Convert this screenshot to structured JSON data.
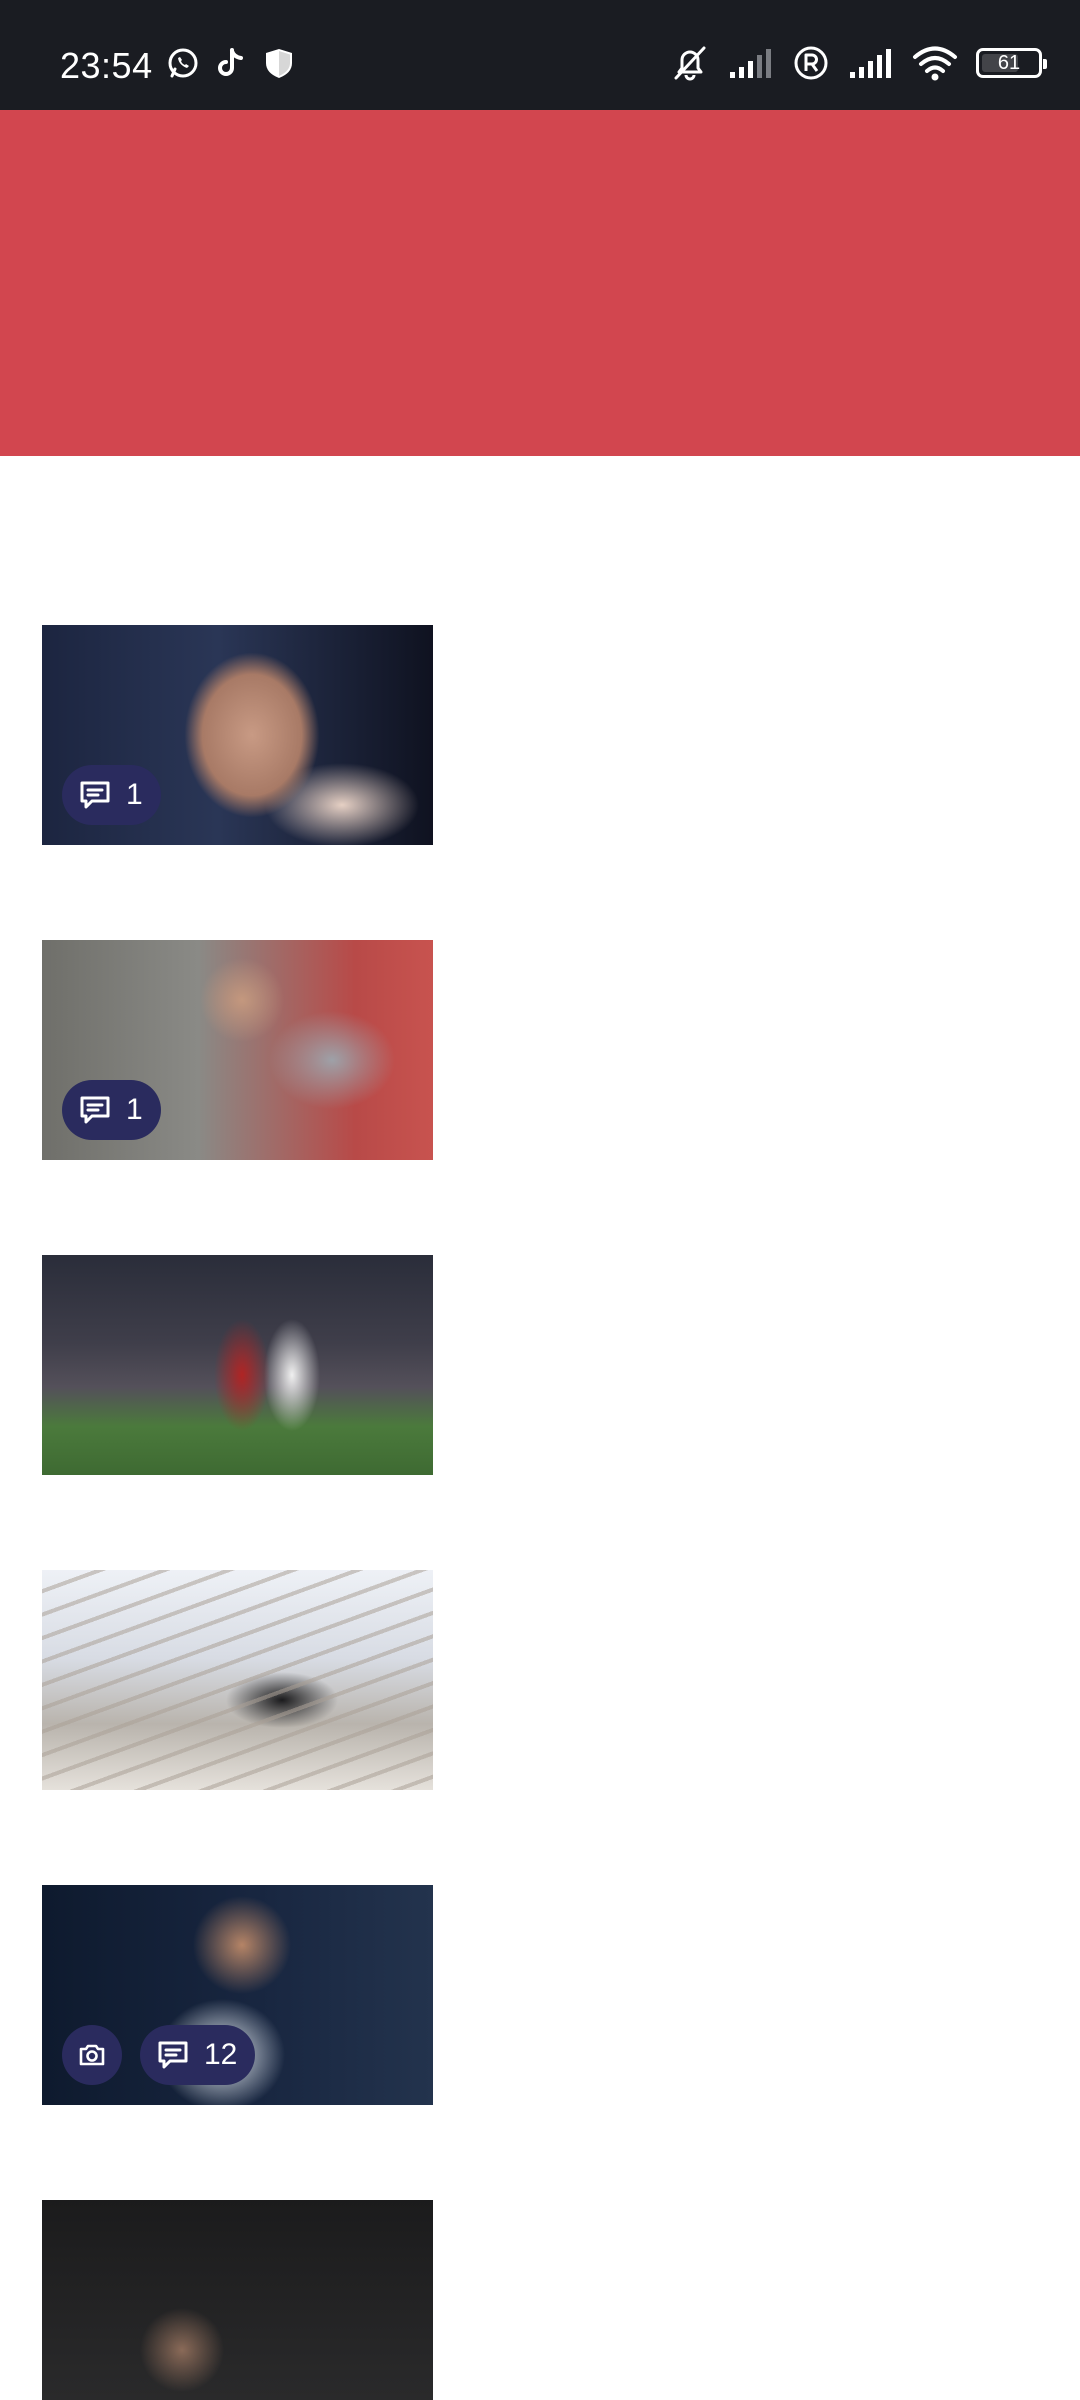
{
  "status_bar": {
    "time": "23:54",
    "left_icons": [
      "whatsapp-icon",
      "tiktok-icon",
      "shield-icon"
    ],
    "right_icons": [
      "mute-icon",
      "signal-weak-icon",
      "roaming-r-icon",
      "signal-icon",
      "wifi-icon"
    ],
    "battery_level": "61",
    "colors": {
      "background": "#1a1c22",
      "foreground": "#ffffff"
    }
  },
  "banner": {
    "color": "#d2464f"
  },
  "badge_color": "#2a2b5e",
  "articles": [
    {
      "comments": "1",
      "has_gallery": false,
      "image": "man-with-hand-on-chin-photo"
    },
    {
      "comments": "1",
      "has_gallery": false,
      "image": "coaches-on-bench-photo"
    },
    {
      "comments": "",
      "has_gallery": false,
      "image": "football-match-action-photo"
    },
    {
      "comments": "",
      "has_gallery": false,
      "image": "man-in-stadium-stands-photo"
    },
    {
      "comments": "12",
      "has_gallery": true,
      "image": "player-celebrating-photo"
    },
    {
      "comments": "",
      "has_gallery": false,
      "image": "player-raising-arm-photo"
    }
  ]
}
